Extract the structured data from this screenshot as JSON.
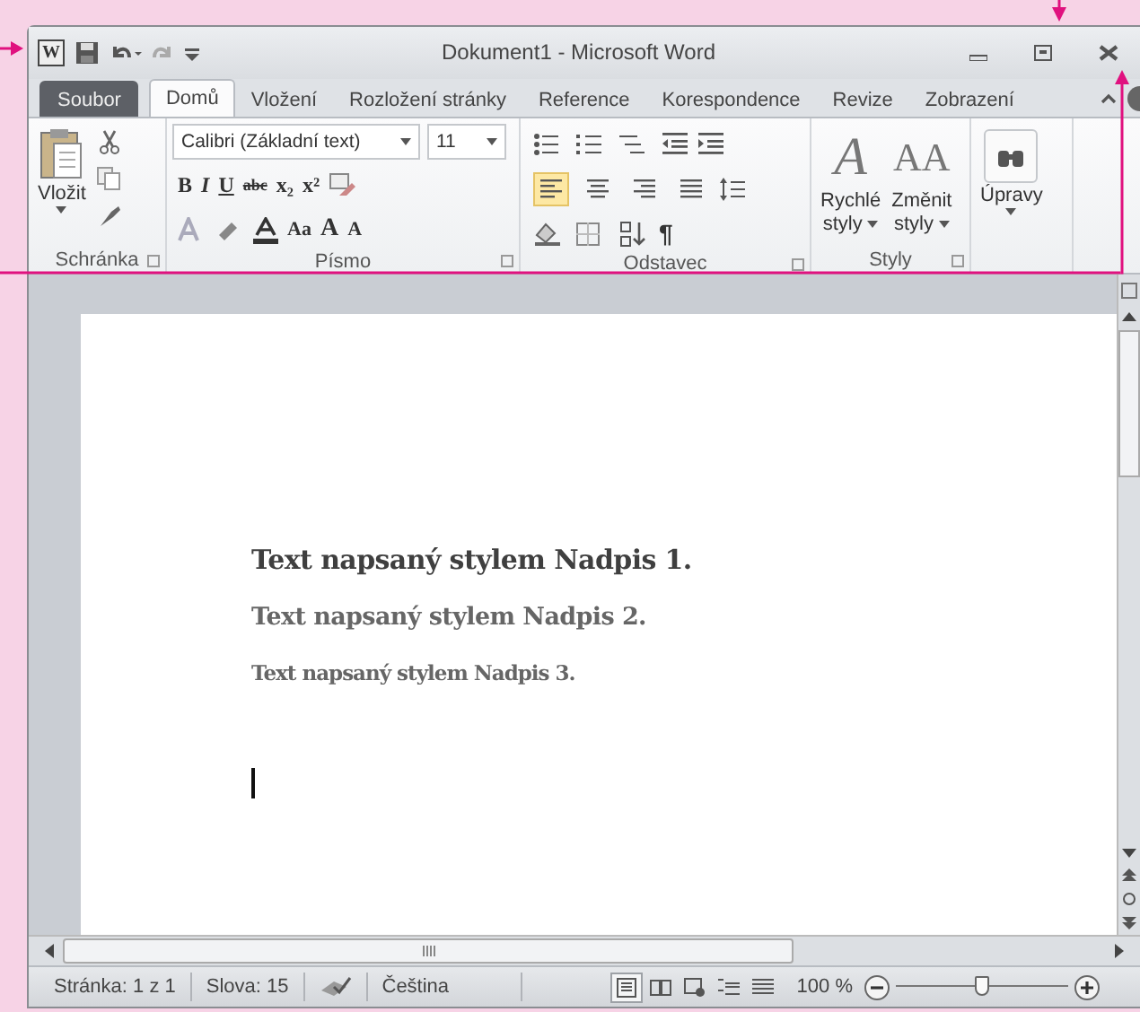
{
  "window": {
    "title": "Dokument1 - Microsoft Word",
    "logo": "W"
  },
  "tabs": [
    {
      "label": "Soubor",
      "kind": "file",
      "selected": false
    },
    {
      "label": "Domů",
      "kind": "tab",
      "selected": true
    },
    {
      "label": "Vložení",
      "kind": "tab",
      "selected": false
    },
    {
      "label": "Rozložení stránky",
      "kind": "tab",
      "selected": false
    },
    {
      "label": "Reference",
      "kind": "tab",
      "selected": false
    },
    {
      "label": "Korespondence",
      "kind": "tab",
      "selected": false
    },
    {
      "label": "Revize",
      "kind": "tab",
      "selected": false
    },
    {
      "label": "Zobrazení",
      "kind": "tab",
      "selected": false
    }
  ],
  "ribbon": {
    "clipboard": {
      "label": "Schránka",
      "paste": "Vložit"
    },
    "font": {
      "label": "Písmo",
      "font_name": "Calibri (Základní text)",
      "font_size": "11",
      "row1": [
        "B",
        "I",
        "U",
        "abc",
        "x₂",
        "x²"
      ],
      "row2": [
        "Aa",
        "A",
        "A"
      ]
    },
    "paragraph": {
      "label": "Odstavec",
      "align": [
        {
          "selected": true
        },
        {
          "selected": false
        },
        {
          "selected": false
        },
        {
          "selected": false
        }
      ],
      "pilcrow": "¶"
    },
    "styles": {
      "label": "Styly",
      "quick_glyph": "A",
      "quick": [
        "Rychlé",
        "styly"
      ],
      "change_glyph": "AA",
      "change": [
        "Změnit",
        "styly"
      ]
    },
    "editing": {
      "label": "Úpravy"
    }
  },
  "document": {
    "paragraphs": [
      {
        "kind": "h1",
        "text": "Text napsaný stylem Nadpis 1."
      },
      {
        "kind": "h2",
        "text": "Text napsaný stylem Nadpis 2."
      },
      {
        "kind": "h3",
        "text": "Text napsaný stylem Nadpis 3."
      }
    ]
  },
  "status_bar": {
    "page": "Stránka: 1 z 1",
    "words": "Slova: 15",
    "language": "Čeština",
    "views": [
      {
        "selected": true
      },
      {
        "selected": false
      },
      {
        "selected": false
      },
      {
        "selected": false
      },
      {
        "selected": false
      }
    ],
    "zoom": "100 %",
    "zoom_slider": {
      "level": 0.5
    }
  }
}
